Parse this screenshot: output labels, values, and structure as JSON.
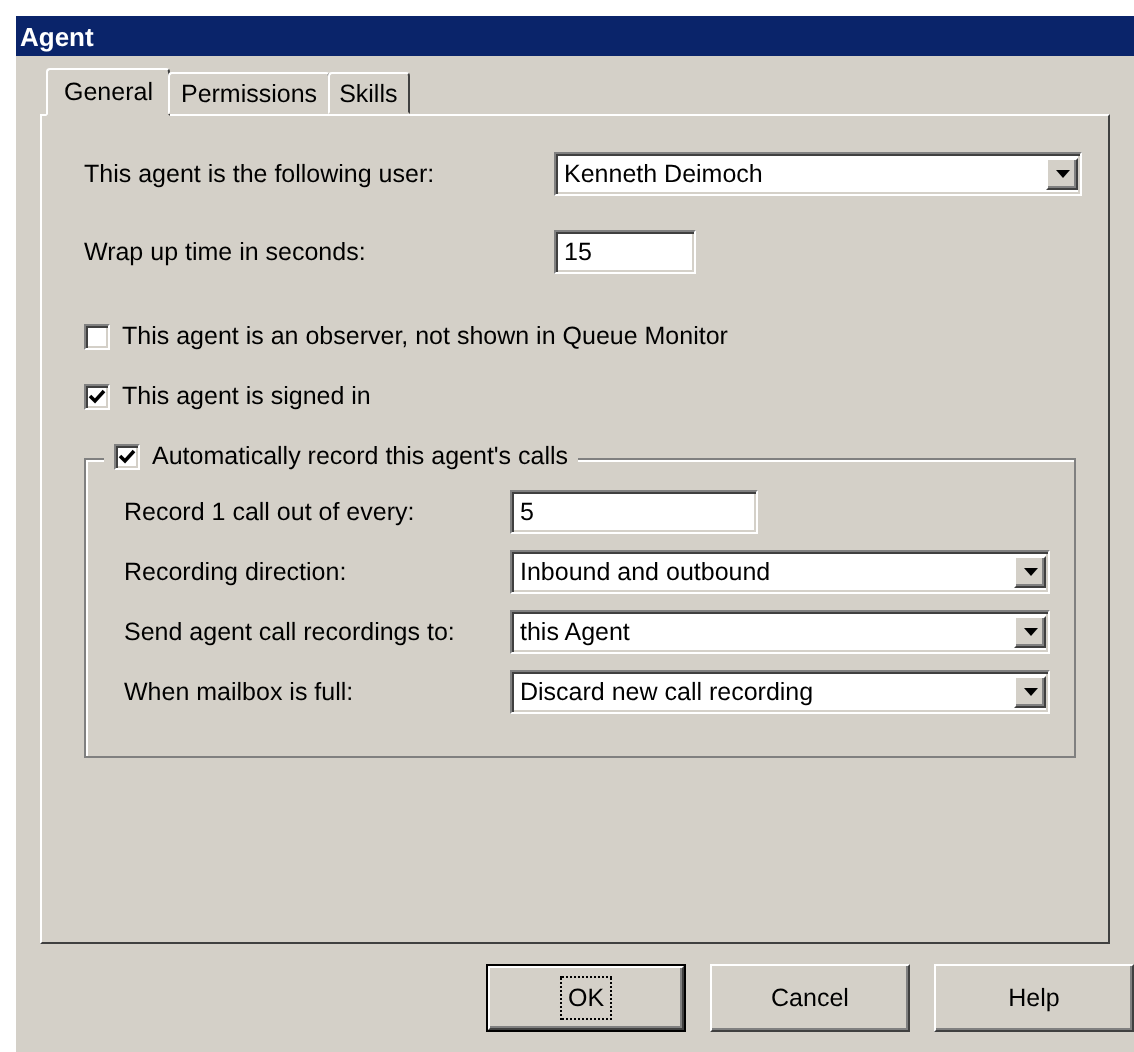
{
  "window": {
    "title": "Agent"
  },
  "tabs": [
    {
      "label": "General",
      "selected": true
    },
    {
      "label": "Permissions",
      "selected": false
    },
    {
      "label": "Skills",
      "selected": false
    }
  ],
  "fields": [
    {
      "kind": "dropdown",
      "label": "This agent is the following user:",
      "value": "Kenneth Deimoch"
    },
    {
      "kind": "text",
      "label": "Wrap up time in seconds:",
      "value": "15"
    }
  ],
  "checkboxes": [
    {
      "label": "This agent is an observer, not shown in Queue Monitor",
      "checked": false
    },
    {
      "label": "This agent is signed in",
      "checked": true
    }
  ],
  "recording": {
    "label": "Automatically record this agent's calls",
    "checked": true,
    "rows": [
      {
        "kind": "text",
        "label": "Record 1 call out of every:",
        "value": "5"
      },
      {
        "kind": "dropdown",
        "label": "Recording direction:",
        "value": "Inbound and outbound"
      },
      {
        "kind": "dropdown",
        "label": "Send agent call recordings to:",
        "value": "this Agent"
      },
      {
        "kind": "dropdown",
        "label": "When mailbox is full:",
        "value": "Discard new call recording"
      }
    ]
  },
  "buttons": [
    {
      "label": "OK",
      "default": true
    },
    {
      "label": "Cancel",
      "default": false
    },
    {
      "label": "Help",
      "default": false
    }
  ]
}
